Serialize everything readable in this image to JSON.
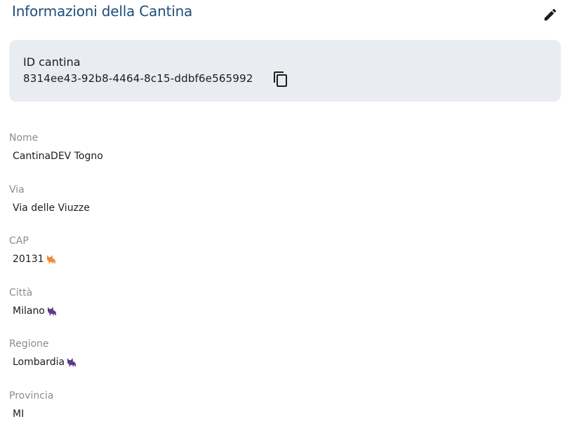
{
  "header": {
    "title": "Informazioni della Cantina",
    "edit_icon": "pencil-icon"
  },
  "id_card": {
    "label": "ID cantina",
    "value": "8314ee43-92b8-4464-8c15-ddbf6e565992",
    "copy_icon": "copy-icon"
  },
  "fields": [
    {
      "label": "Nome",
      "value": "CantinaDEV Togno"
    },
    {
      "label": "Via",
      "value": "Via delle Viuzze"
    },
    {
      "label": "CAP",
      "value": "20131",
      "icon": "cat-icon",
      "icon_color": "#f08a3c"
    },
    {
      "label": "Città",
      "value": "Milano",
      "icon": "cat-icon",
      "icon_color": "#5b3a8c"
    },
    {
      "label": "Regione",
      "value": "Lombardia",
      "icon": "cat-icon",
      "icon_color": "#5b3a8c"
    },
    {
      "label": "Provincia",
      "value": "MI"
    }
  ],
  "colors": {
    "title": "#1f4e79",
    "card_bg": "#e9ecf0",
    "label": "#8c8c8c"
  }
}
